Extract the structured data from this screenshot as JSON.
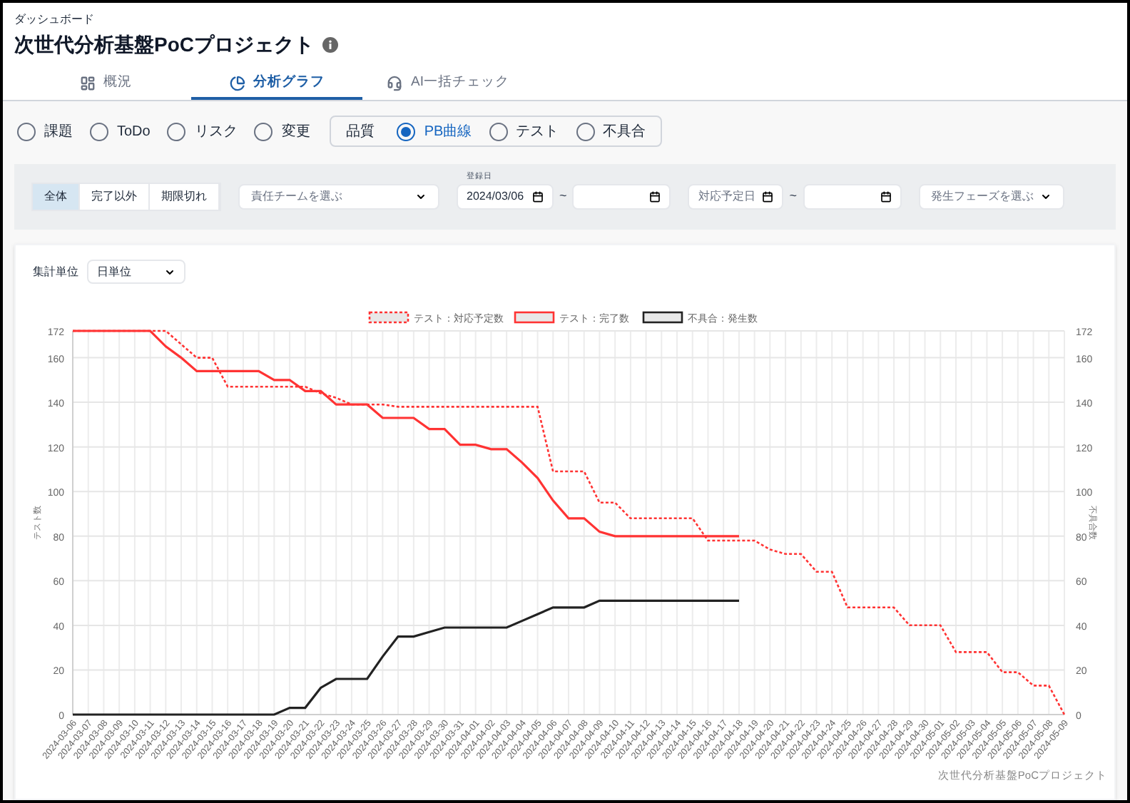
{
  "breadcrumb": "ダッシュボード",
  "title": "次世代分析基盤PoCプロジェクト",
  "tabs": [
    {
      "label": "概況",
      "selected": false
    },
    {
      "label": "分析グラフ",
      "selected": true
    },
    {
      "label": "AI一括チェック",
      "selected": false
    }
  ],
  "categories": [
    {
      "label": "課題",
      "selected": false
    },
    {
      "label": "ToDo",
      "selected": false
    },
    {
      "label": "リスク",
      "selected": false
    },
    {
      "label": "変更",
      "selected": false
    }
  ],
  "quality_group": {
    "label": "品質",
    "options": [
      {
        "label": "PB曲線",
        "selected": true
      },
      {
        "label": "テスト",
        "selected": false
      },
      {
        "label": "不具合",
        "selected": false
      }
    ]
  },
  "filters": {
    "status_buttons": [
      {
        "label": "全体",
        "selected": true
      },
      {
        "label": "完了以外",
        "selected": false
      },
      {
        "label": "期限切れ",
        "selected": false
      }
    ],
    "team_select": {
      "placeholder": "責任チームを選ぶ"
    },
    "registered_from": {
      "label": "登録日",
      "value": "2024/03/06"
    },
    "tilde_1": "~",
    "due_from": {
      "placeholder": "対応予定日"
    },
    "tilde_2": "~",
    "phase_select": {
      "placeholder": "発生フェーズを選ぶ"
    }
  },
  "aggregation": {
    "label": "集計単位",
    "value": "日単位"
  },
  "chart": {
    "footer": "次世代分析基盤PoCプロジェクト",
    "right_ylabel": "不具合数",
    "right_yticks": [
      "172",
      "160",
      "140",
      "120",
      "100",
      "80",
      "60",
      "40",
      "20",
      "0"
    ],
    "chart_data": {
      "type": "line",
      "grid": true,
      "legend": true,
      "ylabel": "テスト数",
      "ylim": [
        0,
        172
      ],
      "yticks": [
        0,
        20,
        40,
        60,
        80,
        100,
        120,
        140,
        160,
        172
      ],
      "categories": [
        "2024-03-06",
        "2024-03-07",
        "2024-03-08",
        "2024-03-09",
        "2024-03-10",
        "2024-03-11",
        "2024-03-12",
        "2024-03-13",
        "2024-03-14",
        "2024-03-15",
        "2024-03-16",
        "2024-03-17",
        "2024-03-18",
        "2024-03-19",
        "2024-03-20",
        "2024-03-21",
        "2024-03-22",
        "2024-03-23",
        "2024-03-24",
        "2024-03-25",
        "2024-03-26",
        "2024-03-27",
        "2024-03-28",
        "2024-03-29",
        "2024-03-30",
        "2024-03-31",
        "2024-04-01",
        "2024-04-02",
        "2024-04-03",
        "2024-04-04",
        "2024-04-05",
        "2024-04-06",
        "2024-04-07",
        "2024-04-08",
        "2024-04-09",
        "2024-04-10",
        "2024-04-11",
        "2024-04-12",
        "2024-04-13",
        "2024-04-14",
        "2024-04-15",
        "2024-04-16",
        "2024-04-17",
        "2024-04-18",
        "2024-04-19",
        "2024-04-20",
        "2024-04-21",
        "2024-04-22",
        "2024-04-23",
        "2024-04-24",
        "2024-04-25",
        "2024-04-26",
        "2024-04-27",
        "2024-04-28",
        "2024-04-29",
        "2024-04-30",
        "2024-05-01",
        "2024-05-02",
        "2024-05-03",
        "2024-05-04",
        "2024-05-05",
        "2024-05-06",
        "2024-05-07",
        "2024-05-08",
        "2024-05-09"
      ],
      "series": [
        {
          "name": "テスト：対応予定数",
          "color": "#ff3333",
          "line_style": "dotted",
          "values": [
            172,
            172,
            172,
            172,
            172,
            172,
            172,
            166,
            160,
            160,
            147,
            147,
            147,
            147,
            147,
            147,
            144,
            142,
            139,
            139,
            139,
            138,
            138,
            138,
            138,
            138,
            138,
            138,
            138,
            138,
            138,
            109,
            109,
            109,
            95,
            95,
            88,
            88,
            88,
            88,
            88,
            78,
            78,
            78,
            78,
            74,
            72,
            72,
            64,
            64,
            48,
            48,
            48,
            48,
            40,
            40,
            40,
            28,
            28,
            28,
            19,
            19,
            13,
            13,
            0
          ]
        },
        {
          "name": "テスト：完了数",
          "color": "#ff3333",
          "line_style": "solid",
          "values": [
            172,
            172,
            172,
            172,
            172,
            172,
            165,
            160,
            154,
            154,
            154,
            154,
            154,
            150,
            150,
            145,
            145,
            139,
            139,
            139,
            133,
            133,
            133,
            128,
            128,
            121,
            121,
            119,
            119,
            113,
            106,
            96,
            88,
            88,
            82,
            80,
            80,
            80,
            80,
            80,
            80,
            80,
            80,
            80,
            null,
            null,
            null,
            null,
            null,
            null,
            null,
            null,
            null,
            null,
            null,
            null,
            null,
            null,
            null,
            null,
            null,
            null,
            null,
            null,
            null
          ]
        },
        {
          "name": "不具合：発生数",
          "color": "#222222",
          "line_style": "solid",
          "values": [
            0,
            0,
            0,
            0,
            0,
            0,
            0,
            0,
            0,
            0,
            0,
            0,
            0,
            0,
            3,
            3,
            12,
            16,
            16,
            16,
            26,
            35,
            35,
            37,
            39,
            39,
            39,
            39,
            39,
            42,
            45,
            48,
            48,
            48,
            51,
            51,
            51,
            51,
            51,
            51,
            51,
            51,
            51,
            51,
            null,
            null,
            null,
            null,
            null,
            null,
            null,
            null,
            null,
            null,
            null,
            null,
            null,
            null,
            null,
            null,
            null,
            null,
            null,
            null,
            null
          ]
        }
      ]
    }
  }
}
